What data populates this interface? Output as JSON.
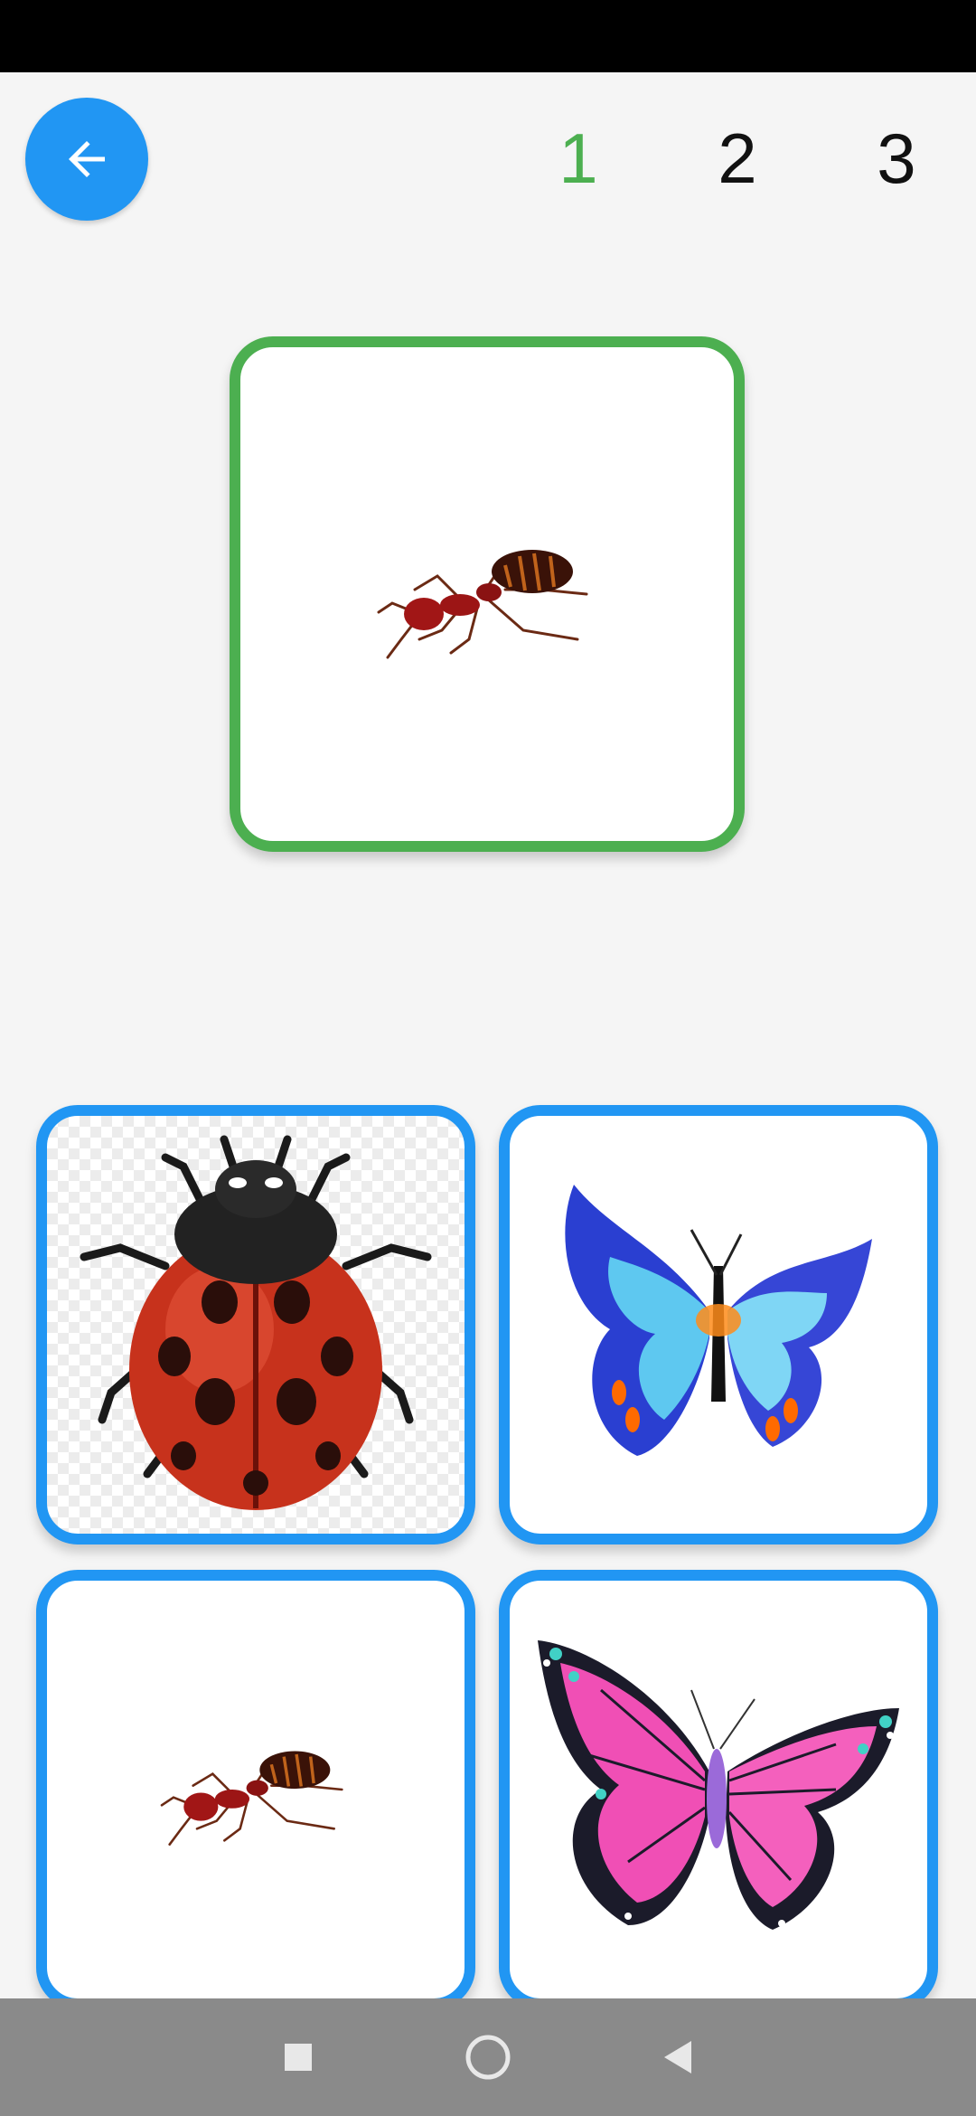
{
  "header": {
    "back_icon": "arrow-left-icon",
    "levels": [
      {
        "label": "1",
        "active": true
      },
      {
        "label": "2",
        "active": false
      },
      {
        "label": "3",
        "active": false
      }
    ]
  },
  "target": {
    "image": "ant"
  },
  "options": [
    {
      "image": "ladybug"
    },
    {
      "image": "blue-butterfly"
    },
    {
      "image": "ant"
    },
    {
      "image": "pink-butterfly"
    }
  ],
  "nav_bar": {
    "recents_icon": "square-icon",
    "home_icon": "circle-icon",
    "back_icon": "triangle-back-icon"
  },
  "colors": {
    "accent_blue": "#2196f3",
    "correct_green": "#4caf50",
    "background": "#f5f5f5"
  }
}
